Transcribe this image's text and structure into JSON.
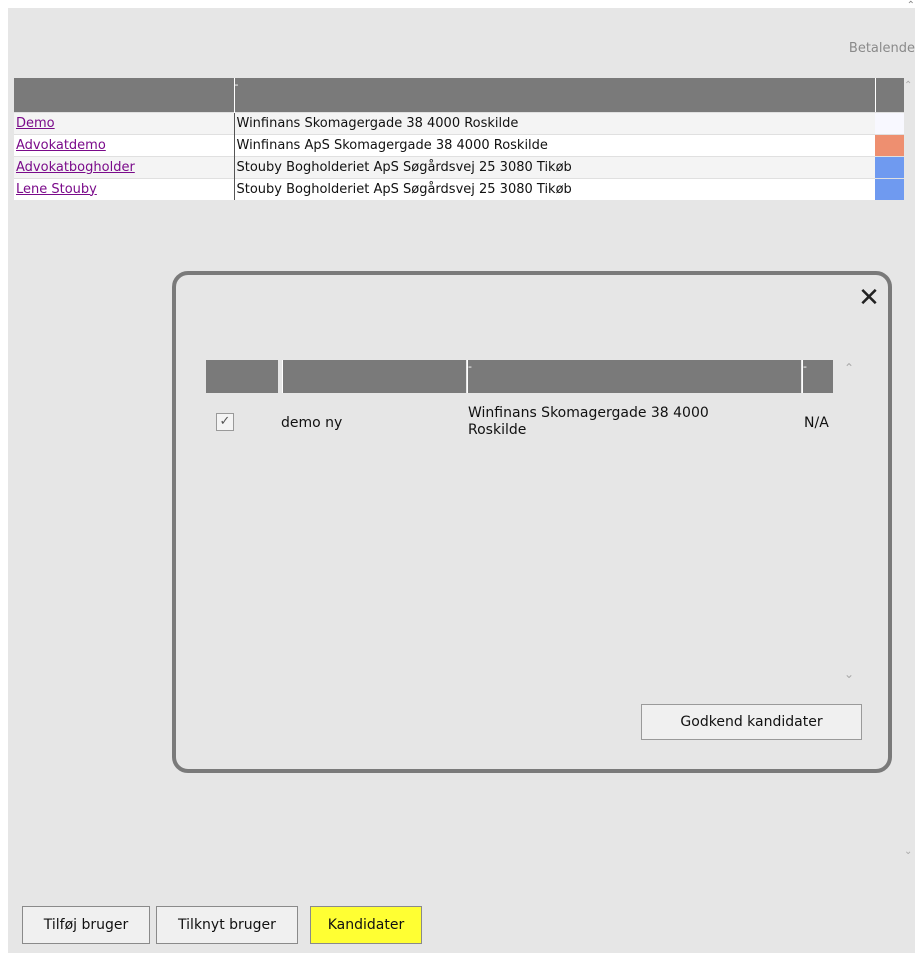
{
  "header": {
    "betalende_label": "Betalende"
  },
  "main_table": {
    "header_dash": "-",
    "rows": [
      {
        "name": "Demo",
        "address": "Winfinans Skomagergade 38 4000 Roskilde",
        "color": "#f8f8ff"
      },
      {
        "name": "Advokatdemo",
        "address": "Winfinans ApS Skomagergade 38 4000 Roskilde",
        "color": "#ee8f70"
      },
      {
        "name": "Advokatbogholder",
        "address": "Stouby Bogholderiet ApS Søgårdsvej 25 3080 Tikøb",
        "color": "#6f9af0"
      },
      {
        "name": "Lene Stouby",
        "address": "Stouby Bogholderiet ApS Søgårdsvej 25 3080 Tikøb",
        "color": "#6f9af0"
      }
    ]
  },
  "modal": {
    "close_glyph": "✕",
    "header_dash_1": "-",
    "header_dash_2": "-",
    "candidate": {
      "checked": true,
      "check_glyph": "✓",
      "name": "demo ny",
      "address_line1": "Winfinans Skomagergade 38 4000",
      "address_line2": "Roskilde",
      "status": "N/A"
    },
    "approve_label": "Godkend kandidater"
  },
  "buttons": {
    "add_user": "Tilføj bruger",
    "link_user": "Tilknyt bruger",
    "candidates": "Kandidater"
  },
  "colors": {
    "highlight": "#ffff33",
    "header": "#7a7a7a",
    "link": "#7a0a8a"
  }
}
